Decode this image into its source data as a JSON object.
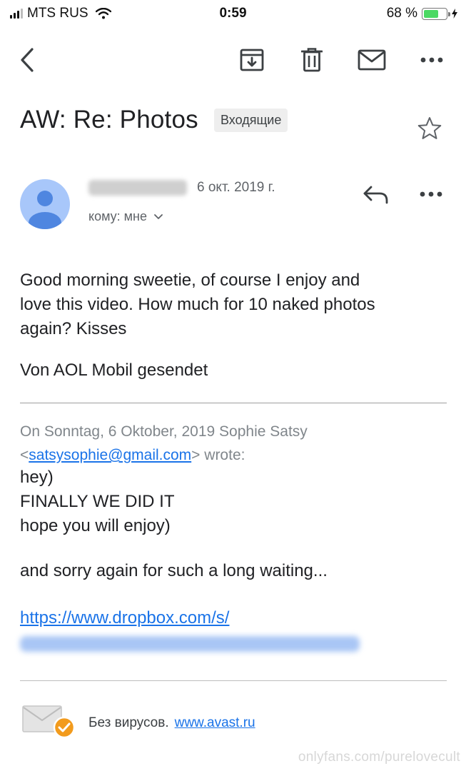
{
  "status_bar": {
    "carrier": "MTS RUS",
    "time": "0:59",
    "battery_percent_label": "68 %",
    "battery_level": 0.68
  },
  "toolbar": {
    "back_icon": "chevron-left-icon",
    "archive_icon": "archive-icon",
    "delete_icon": "trash-icon",
    "mark_unread_icon": "mail-icon",
    "more_icon": "more-horizontal-icon"
  },
  "email": {
    "subject": "AW: Re: Photos",
    "label": "Входящие",
    "date": "6 окт. 2019 г.",
    "to_line": "кому: мне",
    "body_lines": [
      "Good morning sweetie, of course I enjoy and",
      "love this video. How much for 10 naked photos",
      "again? Kisses"
    ],
    "signature": "Von AOL Mobil gesendet",
    "quote_header_line1": "On Sonntag, 6 Oktober, 2019 Sophie Satsy",
    "quote_header_email": "satsysophie@gmail.com",
    "quote_header_suffix": " wrote:",
    "quote_lines": [
      "hey)",
      "FINALLY WE DID IT",
      "hope you will enjoy)"
    ],
    "quote_sorry": "and sorry again for such a long waiting...",
    "dropbox_link": "https://www.dropbox.com/s/"
  },
  "footer": {
    "avast_text": "Без вирусов.",
    "avast_link": "www.avast.ru",
    "watermark": "onlyfans.com/purelovecult"
  },
  "colors": {
    "link": "#1a73e8",
    "avatar_bg": "#a8c7fa",
    "avatar_fg": "#4f86e0",
    "battery_fill": "#4cd964",
    "avast_badge": "#f29b1d"
  }
}
